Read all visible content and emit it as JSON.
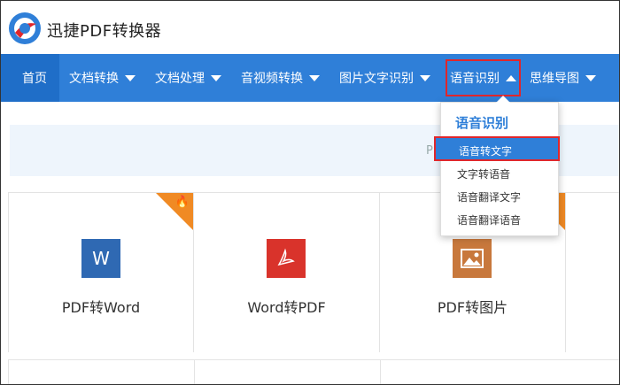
{
  "app": {
    "title": "迅捷PDF转换器"
  },
  "nav": {
    "items": [
      {
        "label": "首页"
      },
      {
        "label": "文档转换"
      },
      {
        "label": "文档处理"
      },
      {
        "label": "音视频转换"
      },
      {
        "label": "图片文字识别"
      },
      {
        "label": "语音识别"
      },
      {
        "label": "思维导图"
      }
    ]
  },
  "dropdown": {
    "title": "语音识别",
    "items": [
      "语音转文字",
      "文字转语音",
      "语音翻译文字",
      "语音翻译语音"
    ]
  },
  "banner": {
    "text": "PI"
  },
  "cards": [
    {
      "label": "PDF转Word",
      "icon": "word-icon",
      "glyph": "W",
      "color": "#2f69b3",
      "hot": true
    },
    {
      "label": "Word转PDF",
      "icon": "pdf-icon",
      "glyph": "⚘",
      "color": "#d9332b",
      "hot": false
    },
    {
      "label": "PDF转图片",
      "icon": "image-icon",
      "glyph": "▲",
      "color": "#c8783c",
      "hot": true
    }
  ],
  "colors": {
    "nav": "#2f7fd8",
    "highlight": "#e0262b",
    "hot": "#f08a24"
  }
}
